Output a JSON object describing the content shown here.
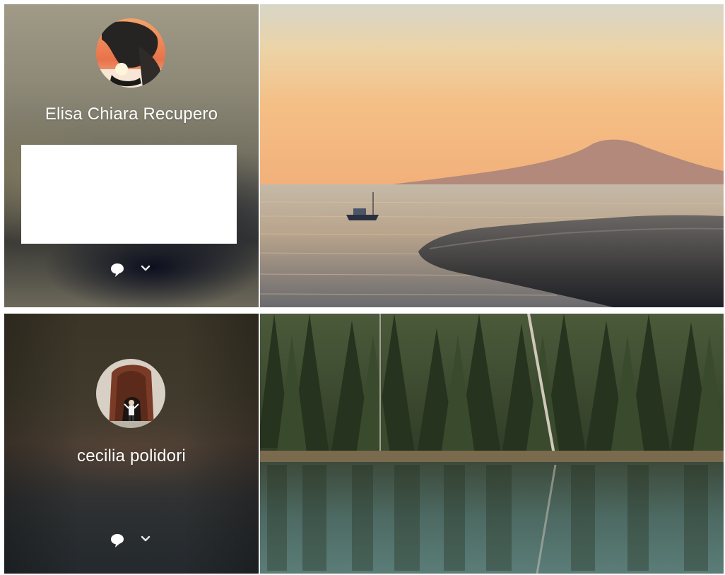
{
  "posts": [
    {
      "author": "Elisa Chiara Recupero",
      "icons": {
        "comment": "speech-bubble-icon",
        "expand": "chevron-down-icon"
      },
      "photo": "sunset-sea-photo"
    },
    {
      "author": "cecilia polidori",
      "icons": {
        "comment": "speech-bubble-icon",
        "expand": "chevron-down-icon"
      },
      "photo": "forest-lake-photo"
    }
  ],
  "colors": {
    "text": "#ffffff",
    "content_box": "#ffffff"
  }
}
